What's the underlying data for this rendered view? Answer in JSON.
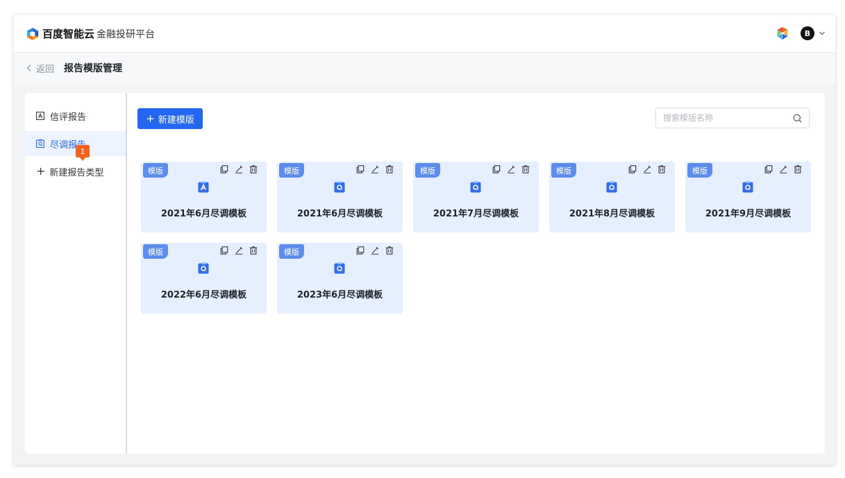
{
  "header": {
    "brand": "百度智能云",
    "platform": "金融投研平台",
    "avatar_letter": "B",
    "icons": [
      "baidu-cloud-logo-icon",
      "app-switcher-icon",
      "chevron-down-icon"
    ]
  },
  "subheader": {
    "back_label": "返回",
    "title": "报告模版管理"
  },
  "sidebar": {
    "items": [
      {
        "label": "信评报告",
        "icon": "report-a-icon",
        "active": false
      },
      {
        "label": "尽调报告",
        "icon": "report-search-icon",
        "active": true
      }
    ],
    "add_label": "新建报告类型",
    "badge": "1"
  },
  "toolbar": {
    "new_template_label": "新建模版",
    "search_placeholder": "搜索模版名称"
  },
  "templates": [
    {
      "tag": "模版",
      "title": "2021年6月尽调模板",
      "icon": "doc-a-icon"
    },
    {
      "tag": "模版",
      "title": "2021年6月尽调模板",
      "icon": "doc-search-icon"
    },
    {
      "tag": "模版",
      "title": "2021年7月尽调模板",
      "icon": "doc-search-icon"
    },
    {
      "tag": "模版",
      "title": "2021年8月尽调模板",
      "icon": "doc-search-icon"
    },
    {
      "tag": "模版",
      "title": "2021年9月尽调模板",
      "icon": "doc-search-icon"
    },
    {
      "tag": "模版",
      "title": "2022年6月尽调模板",
      "icon": "doc-search-icon"
    },
    {
      "tag": "模版",
      "title": "2023年6月尽调模板",
      "icon": "doc-search-icon"
    }
  ],
  "colors": {
    "primary": "#2468f2",
    "card_bg": "#e6effd",
    "tag_bg": "#5b8def",
    "badge": "#f5621e"
  }
}
